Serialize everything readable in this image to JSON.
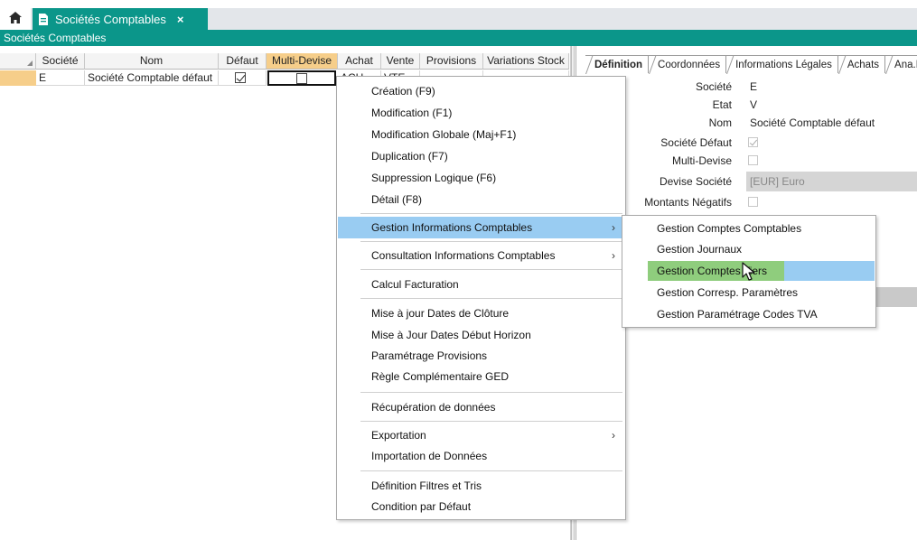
{
  "tab": {
    "title": "Sociétés Comptables",
    "close": "×"
  },
  "section_title": "Sociétés Comptables",
  "grid": {
    "columns": [
      "Société",
      "Nom",
      "Défaut",
      "Multi-Devise",
      "Achat",
      "Vente",
      "Provisions",
      "Variations Stock"
    ],
    "row": {
      "societe": "E",
      "nom": "Société Comptable défaut",
      "defaut": true,
      "achat": "ACH",
      "vente": "VTE"
    }
  },
  "right_panel": {
    "tabs": [
      "Définition",
      "Coordonnées",
      "Informations Légales",
      "Achats",
      "Ana.Es"
    ],
    "fields": {
      "societe_label": "Société",
      "societe_val": "E",
      "etat_label": "Etat",
      "etat_val": "V",
      "nom_label": "Nom",
      "nom_val": "Société Comptable défaut",
      "defaut_label": "Société Défaut",
      "multi_label": "Multi-Devise",
      "devise_label": "Devise Société",
      "devise_val": "[EUR] Euro",
      "montants_label": "Montants Négatifs"
    }
  },
  "context_menu": {
    "items": [
      "Création (F9)",
      "Modification (F1)",
      "Modification Globale (Maj+F1)",
      "Duplication (F7)",
      "Suppression Logique (F6)",
      "Détail (F8)",
      "Gestion Informations Comptables",
      "Consultation Informations Comptables",
      "Calcul Facturation",
      "Mise à jour Dates de Clôture",
      "Mise à Jour Dates Début Horizon",
      "Paramétrage Provisions",
      "Règle Complémentaire GED",
      "Récupération de données",
      "Exportation",
      "Importation de Données",
      "Définition Filtres et Tris",
      "Condition par Défaut"
    ],
    "arrow": "›"
  },
  "submenu": {
    "items": [
      "Gestion Comptes Comptables",
      "Gestion Journaux",
      "Gestion Comptes Tiers",
      "Gestion Corresp. Paramètres",
      "Gestion Paramétrage Codes TVA"
    ]
  },
  "colors": {
    "teal": "#0b968a",
    "orange": "#f6ce8a",
    "menu_highlight": "#99ccf2",
    "green_highlight": "#8fcd7d"
  }
}
